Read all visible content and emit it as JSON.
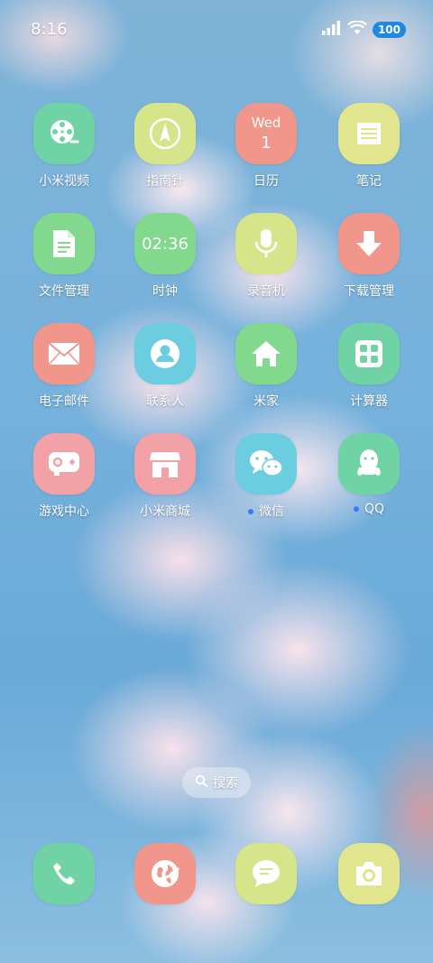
{
  "status_bar": {
    "time": "8:16",
    "battery": "100"
  },
  "apps": [
    {
      "label": "小米视频",
      "icon": "film-reel-icon",
      "color": "#6fd3a6"
    },
    {
      "label": "指南针",
      "icon": "compass-icon",
      "color": "#d6e48a"
    },
    {
      "label": "日历",
      "icon": "calendar-icon",
      "color": "#f0968b",
      "day": "Wed",
      "date": "1"
    },
    {
      "label": "笔记",
      "icon": "notes-icon",
      "color": "#e1e58d"
    },
    {
      "label": "文件管理",
      "icon": "file-icon",
      "color": "#82d98d"
    },
    {
      "label": "时钟",
      "icon": "clock-icon",
      "color": "#82d98d",
      "clock": "02:36"
    },
    {
      "label": "录音机",
      "icon": "microphone-icon",
      "color": "#d6e48a"
    },
    {
      "label": "下载管理",
      "icon": "download-icon",
      "color": "#f0968b"
    },
    {
      "label": "电子邮件",
      "icon": "mail-icon",
      "color": "#f0968b"
    },
    {
      "label": "联系人",
      "icon": "contact-icon",
      "color": "#6ccde0"
    },
    {
      "label": "米家",
      "icon": "home-icon",
      "color": "#82d98d"
    },
    {
      "label": "计算器",
      "icon": "calculator-icon",
      "color": "#6fd3a6"
    },
    {
      "label": "游戏中心",
      "icon": "gamepad-icon",
      "color": "#f2a1a6"
    },
    {
      "label": "小米商城",
      "icon": "store-icon",
      "color": "#f2a1a6"
    },
    {
      "label": "微信",
      "icon": "wechat-icon",
      "color": "#6ccde0",
      "notify": true
    },
    {
      "label": "QQ",
      "icon": "qq-penguin-icon",
      "color": "#6fd3a6",
      "notify": true
    }
  ],
  "search": {
    "label": "搜索"
  },
  "dock": [
    {
      "name": "phone",
      "icon": "phone-icon",
      "color": "#6fd3a6"
    },
    {
      "name": "browser",
      "icon": "globe-icon",
      "color": "#f0968b"
    },
    {
      "name": "messages",
      "icon": "message-bubble-icon",
      "color": "#d6e48a"
    },
    {
      "name": "camera",
      "icon": "camera-icon",
      "color": "#e1e58d"
    }
  ]
}
